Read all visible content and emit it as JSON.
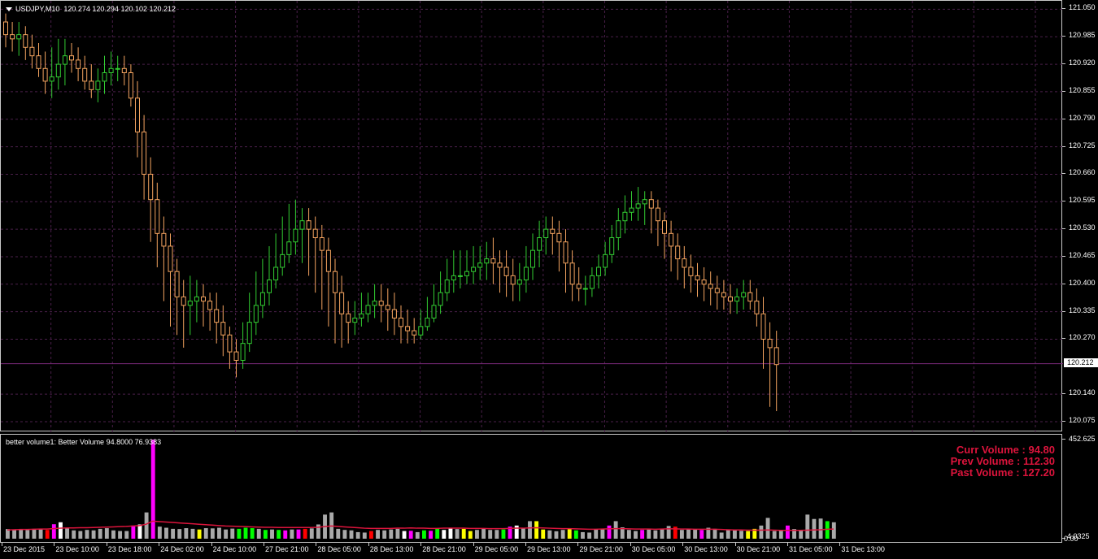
{
  "header": {
    "symbol": "USDJPY,M10",
    "ohlc": "120.274 120.294 120.102 120.212"
  },
  "price_axis": {
    "labels": [
      "121.050",
      "120.985",
      "120.920",
      "120.855",
      "120.790",
      "120.725",
      "120.660",
      "120.595",
      "120.530",
      "120.465",
      "120.400",
      "120.335",
      "120.270",
      "120.140",
      "120.075"
    ],
    "current_price": "120.212"
  },
  "indicator": {
    "title": "better volume1:  Better Volume 94.8000 76.9383",
    "axis_top": "452.625",
    "axis_bottom": "0.00",
    "axis_bottom_overlap": "4.0325",
    "curr_volume": "Curr Volume : 94.80",
    "prev_volume": "Prev Volume : 112.30",
    "past_volume": "Past Volume : 127.20"
  },
  "time_axis": {
    "labels": [
      "23 Dec 2015",
      "23 Dec 10:00",
      "23 Dec 18:00",
      "24 Dec 02:00",
      "24 Dec 10:00",
      "27 Dec 21:00",
      "28 Dec 05:00",
      "28 Dec 13:00",
      "28 Dec 21:00",
      "29 Dec 05:00",
      "29 Dec 13:00",
      "29 Dec 21:00",
      "30 Dec 05:00",
      "30 Dec 13:00",
      "30 Dec 21:00",
      "31 Dec 05:00",
      "31 Dec 13:00"
    ]
  },
  "colors": {
    "background": "#000000",
    "bull": "#32cd32",
    "bear": "#f4a460",
    "grid": "#4a1f4a",
    "volume_gray": "#a9a9a9",
    "volume_magenta": "#ff00ff",
    "volume_red": "#ff0000",
    "volume_green": "#00ff00",
    "volume_white": "#ffffff",
    "volume_yellow": "#ffff00",
    "average_line": "#dc143c"
  },
  "chart_data": {
    "type": "candlestick",
    "symbol": "USDJPY",
    "timeframe": "M10",
    "ylim": [
      120.05,
      121.07
    ],
    "open": [
      121.02,
      120.99,
      120.98,
      120.99,
      120.96,
      120.94,
      120.91,
      120.88,
      120.89,
      120.92,
      120.94,
      120.93,
      120.91,
      120.88,
      120.86,
      120.88,
      120.9,
      120.91,
      120.91,
      120.9,
      120.84,
      120.76,
      120.66,
      120.6,
      120.52,
      120.49,
      120.43,
      120.37,
      120.35,
      120.36,
      120.37,
      120.36,
      120.34,
      120.31,
      120.28,
      120.24,
      120.22,
      120.26,
      120.31,
      120.35,
      120.38,
      120.41,
      120.44,
      120.47,
      120.5,
      120.53,
      120.55,
      120.53,
      120.51,
      120.48,
      120.43,
      120.38,
      120.33,
      120.31,
      120.32,
      120.33,
      120.35,
      120.36,
      120.35,
      120.34,
      120.32,
      120.3,
      120.29,
      120.28,
      120.3,
      120.32,
      120.35,
      120.38,
      120.41,
      120.42,
      120.42,
      120.43,
      120.44,
      120.45,
      120.46,
      120.45,
      120.44,
      120.42,
      120.4,
      120.41,
      120.44,
      120.48,
      120.51,
      120.53,
      120.52,
      120.5,
      120.45,
      120.4,
      120.39,
      120.39,
      120.42,
      120.44,
      120.47,
      120.51,
      120.55,
      120.57,
      120.58,
      120.59,
      120.6,
      120.58,
      120.55,
      120.52,
      120.49,
      120.46,
      120.44,
      120.42,
      120.41,
      120.4,
      120.39,
      120.38,
      120.37,
      120.36,
      120.37,
      120.38,
      120.36,
      120.33,
      120.27,
      120.25
    ],
    "high": [
      121.04,
      121.02,
      121.02,
      121.01,
      120.99,
      120.97,
      120.95,
      120.96,
      120.98,
      120.98,
      120.97,
      120.96,
      120.94,
      120.92,
      120.91,
      120.94,
      120.95,
      120.94,
      120.94,
      120.92,
      120.88,
      120.8,
      120.7,
      120.64,
      120.56,
      120.52,
      120.46,
      120.41,
      120.42,
      120.41,
      120.4,
      120.38,
      120.38,
      120.35,
      120.3,
      120.27,
      120.31,
      120.38,
      120.43,
      120.46,
      120.49,
      120.52,
      120.56,
      120.59,
      120.6,
      120.58,
      120.58,
      120.56,
      120.54,
      120.51,
      120.46,
      120.42,
      120.36,
      120.36,
      120.38,
      120.38,
      120.4,
      120.4,
      120.39,
      120.38,
      120.35,
      120.34,
      120.32,
      120.34,
      120.37,
      120.4,
      120.43,
      120.46,
      120.48,
      120.48,
      120.48,
      120.49,
      120.49,
      120.5,
      120.51,
      120.48,
      120.48,
      120.46,
      120.45,
      120.49,
      120.52,
      120.55,
      120.56,
      120.56,
      120.55,
      120.53,
      120.48,
      120.44,
      120.42,
      120.44,
      120.47,
      120.5,
      120.54,
      120.58,
      120.61,
      120.62,
      120.63,
      120.62,
      120.62,
      120.6,
      120.57,
      120.55,
      120.52,
      120.49,
      120.47,
      120.45,
      120.44,
      120.43,
      120.42,
      120.41,
      120.4,
      120.39,
      120.41,
      120.41,
      120.39,
      120.37,
      120.31,
      120.29
    ],
    "low": [
      120.96,
      120.95,
      120.94,
      120.93,
      120.91,
      120.89,
      120.85,
      120.84,
      120.86,
      120.87,
      120.9,
      120.88,
      120.86,
      120.84,
      120.83,
      120.85,
      120.87,
      120.88,
      120.87,
      120.82,
      120.7,
      120.6,
      120.5,
      120.44,
      120.36,
      120.3,
      120.28,
      120.25,
      120.28,
      120.31,
      120.3,
      120.29,
      120.26,
      120.23,
      120.2,
      120.18,
      120.2,
      120.24,
      120.28,
      120.32,
      120.35,
      120.39,
      120.42,
      120.45,
      120.47,
      120.45,
      120.42,
      120.38,
      120.34,
      120.3,
      120.26,
      120.25,
      120.26,
      120.28,
      120.3,
      120.31,
      120.32,
      120.31,
      120.29,
      120.28,
      120.26,
      120.26,
      120.26,
      120.27,
      120.29,
      120.31,
      120.33,
      120.36,
      120.38,
      120.39,
      120.4,
      120.4,
      120.41,
      120.41,
      120.4,
      120.38,
      120.37,
      120.36,
      120.36,
      120.38,
      120.41,
      120.44,
      120.47,
      120.47,
      120.43,
      120.38,
      120.36,
      120.36,
      120.35,
      120.37,
      120.39,
      120.42,
      120.45,
      120.48,
      120.52,
      120.55,
      120.55,
      120.54,
      120.52,
      120.49,
      120.46,
      120.43,
      120.41,
      120.39,
      120.38,
      120.37,
      120.36,
      120.35,
      120.34,
      120.34,
      120.33,
      120.33,
      120.34,
      120.34,
      120.3,
      120.2,
      120.11,
      120.1
    ],
    "close": [
      120.99,
      120.98,
      120.99,
      120.96,
      120.94,
      120.91,
      120.88,
      120.89,
      120.92,
      120.94,
      120.93,
      120.91,
      120.88,
      120.86,
      120.88,
      120.9,
      120.91,
      120.91,
      120.9,
      120.84,
      120.76,
      120.66,
      120.6,
      120.52,
      120.49,
      120.43,
      120.37,
      120.35,
      120.36,
      120.37,
      120.36,
      120.34,
      120.31,
      120.28,
      120.24,
      120.22,
      120.26,
      120.31,
      120.35,
      120.38,
      120.41,
      120.44,
      120.47,
      120.5,
      120.53,
      120.55,
      120.53,
      120.51,
      120.48,
      120.43,
      120.38,
      120.33,
      120.31,
      120.32,
      120.33,
      120.35,
      120.36,
      120.35,
      120.34,
      120.32,
      120.3,
      120.29,
      120.28,
      120.3,
      120.32,
      120.35,
      120.38,
      120.41,
      120.42,
      120.42,
      120.43,
      120.44,
      120.45,
      120.46,
      120.45,
      120.44,
      120.42,
      120.4,
      120.41,
      120.44,
      120.48,
      120.51,
      120.53,
      120.52,
      120.5,
      120.45,
      120.4,
      120.39,
      120.39,
      120.42,
      120.44,
      120.47,
      120.51,
      120.55,
      120.57,
      120.58,
      120.59,
      120.6,
      120.58,
      120.55,
      120.52,
      120.49,
      120.46,
      120.44,
      120.42,
      120.41,
      120.4,
      120.39,
      120.38,
      120.37,
      120.36,
      120.37,
      120.38,
      120.36,
      120.33,
      120.27,
      120.25,
      120.21
    ],
    "volume_series": {
      "name": "Better Volume",
      "values": [
        44,
        42,
        44,
        40,
        45,
        43,
        40,
        66,
        75,
        50,
        38,
        35,
        40,
        38,
        45,
        48,
        38,
        35,
        35,
        60,
        65,
        120,
        452,
        55,
        50,
        45,
        44,
        48,
        45,
        42,
        48,
        47,
        50,
        42,
        46,
        45,
        50,
        48,
        45,
        40,
        42,
        40,
        38,
        42,
        42,
        45,
        47,
        65,
        110,
        120,
        45,
        40,
        38,
        30,
        28,
        35,
        40,
        38,
        42,
        45,
        35,
        36,
        30,
        38,
        36,
        45,
        40,
        48,
        44,
        45,
        35,
        40,
        45,
        40,
        40,
        42,
        55,
        60,
        50,
        80,
        80,
        42,
        38,
        34,
        40,
        44,
        38,
        30,
        28,
        42,
        45,
        60,
        80,
        52,
        40,
        35,
        40,
        42,
        38,
        44,
        58,
        55,
        40,
        46,
        42,
        40,
        50,
        45,
        28,
        40,
        38,
        36,
        35,
        45,
        60,
        95,
        35,
        38,
        60,
        44,
        40,
        110,
        90,
        92,
        80,
        75
      ],
      "colors": [
        "gray",
        "gray",
        "gray",
        "gray",
        "gray",
        "gray",
        "red",
        "magenta",
        "white",
        "gray",
        "gray",
        "gray",
        "gray",
        "gray",
        "gray",
        "gray",
        "gray",
        "gray",
        "gray",
        "magenta",
        "white",
        "gray",
        "magenta",
        "gray",
        "gray",
        "gray",
        "gray",
        "gray",
        "gray",
        "yellow",
        "gray",
        "gray",
        "gray",
        "gray",
        "gray",
        "green",
        "green",
        "green",
        "gray",
        "green",
        "gray",
        "green",
        "magenta",
        "gray",
        "magenta",
        "red",
        "gray",
        "gray",
        "gray",
        "gray",
        "gray",
        "gray",
        "gray",
        "gray",
        "gray",
        "red",
        "gray",
        "gray",
        "gray",
        "gray",
        "white",
        "magenta",
        "gray",
        "green",
        "magenta",
        "green",
        "white",
        "white",
        "gray",
        "yellow",
        "yellow",
        "gray",
        "gray",
        "gray",
        "gray",
        "green",
        "magenta",
        "white",
        "gray",
        "gray",
        "yellow",
        "yellow",
        "gray",
        "gray",
        "gray",
        "yellow",
        "green",
        "gray",
        "gray",
        "gray",
        "gray",
        "magenta",
        "gray",
        "gray",
        "gray",
        "gray",
        "magenta",
        "gray",
        "gray",
        "gray",
        "gray",
        "red",
        "gray",
        "gray",
        "gray",
        "magenta",
        "gray",
        "gray",
        "gray",
        "gray",
        "gray",
        "gray",
        "yellow",
        "yellow",
        "gray",
        "gray",
        "gray",
        "gray",
        "magenta",
        "gray",
        "gray",
        "gray",
        "gray",
        "gray",
        "green",
        "gray",
        "gray",
        "green",
        "gray",
        "magenta",
        "gray",
        "gray",
        "gray",
        "gray",
        "green",
        "gray",
        "magenta",
        "gray",
        "red",
        "red",
        "red",
        "gray",
        "gray"
      ],
      "average_values": [
        40,
        41,
        42,
        42,
        43,
        44,
        44,
        46,
        48,
        49,
        49,
        50,
        50,
        51,
        52,
        53,
        54,
        55,
        56,
        58,
        60,
        66,
        80,
        78,
        76,
        74,
        72,
        70,
        68,
        66,
        64,
        62,
        60,
        58,
        57,
        56,
        55,
        54,
        53,
        52,
        52,
        51,
        51,
        51,
        51,
        51,
        51,
        52,
        55,
        58,
        56,
        54,
        52,
        50,
        48,
        47,
        47,
        47,
        47,
        48,
        48,
        49,
        48,
        48,
        47,
        47,
        48,
        48,
        48,
        48,
        47,
        47,
        47,
        46,
        46,
        46,
        47,
        48,
        48,
        49,
        50,
        49,
        48,
        47,
        46,
        46,
        45,
        44,
        43,
        43,
        44,
        45,
        46,
        46,
        45,
        44,
        44,
        44,
        43,
        44,
        45,
        45,
        44,
        44,
        43,
        43,
        43,
        43,
        42,
        41,
        40,
        40,
        39,
        39,
        39,
        40,
        39,
        38,
        38,
        38,
        38,
        39,
        40,
        41,
        43,
        44
      ]
    },
    "price_axis_ticks": [
      121.05,
      120.985,
      120.92,
      120.855,
      120.79,
      120.725,
      120.66,
      120.595,
      120.53,
      120.465,
      120.4,
      120.335,
      120.27,
      120.14,
      120.075
    ],
    "volume_ylim": [
      0,
      452.625
    ]
  }
}
